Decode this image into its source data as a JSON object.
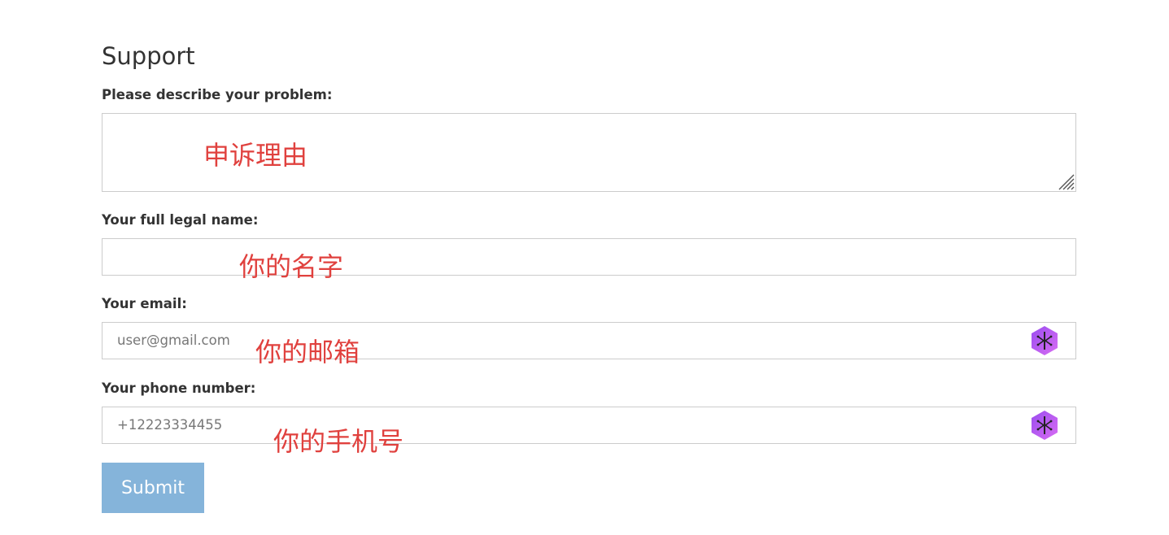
{
  "page": {
    "title": "Support"
  },
  "form": {
    "problem_label": "Please describe your problem:",
    "problem_value": "",
    "name_label": "Your full legal name:",
    "name_value": "",
    "email_label": "Your email:",
    "email_placeholder": "user@gmail.com",
    "phone_label": "Your phone number:",
    "phone_placeholder": "+12223334455",
    "submit_label": "Submit"
  },
  "annotations": {
    "problem": "申诉理由",
    "name": "你的名字",
    "email": "你的邮箱",
    "phone": "你的手机号"
  },
  "icons": {
    "field_extension": "purple-hexagon-extension-icon",
    "textarea_resize": "resize-handle-icon"
  },
  "colors": {
    "submit_bg": "#85b4da",
    "annotation": "#e0413e",
    "field_border": "#cccccc",
    "extension_icon": "#b05cf0"
  }
}
